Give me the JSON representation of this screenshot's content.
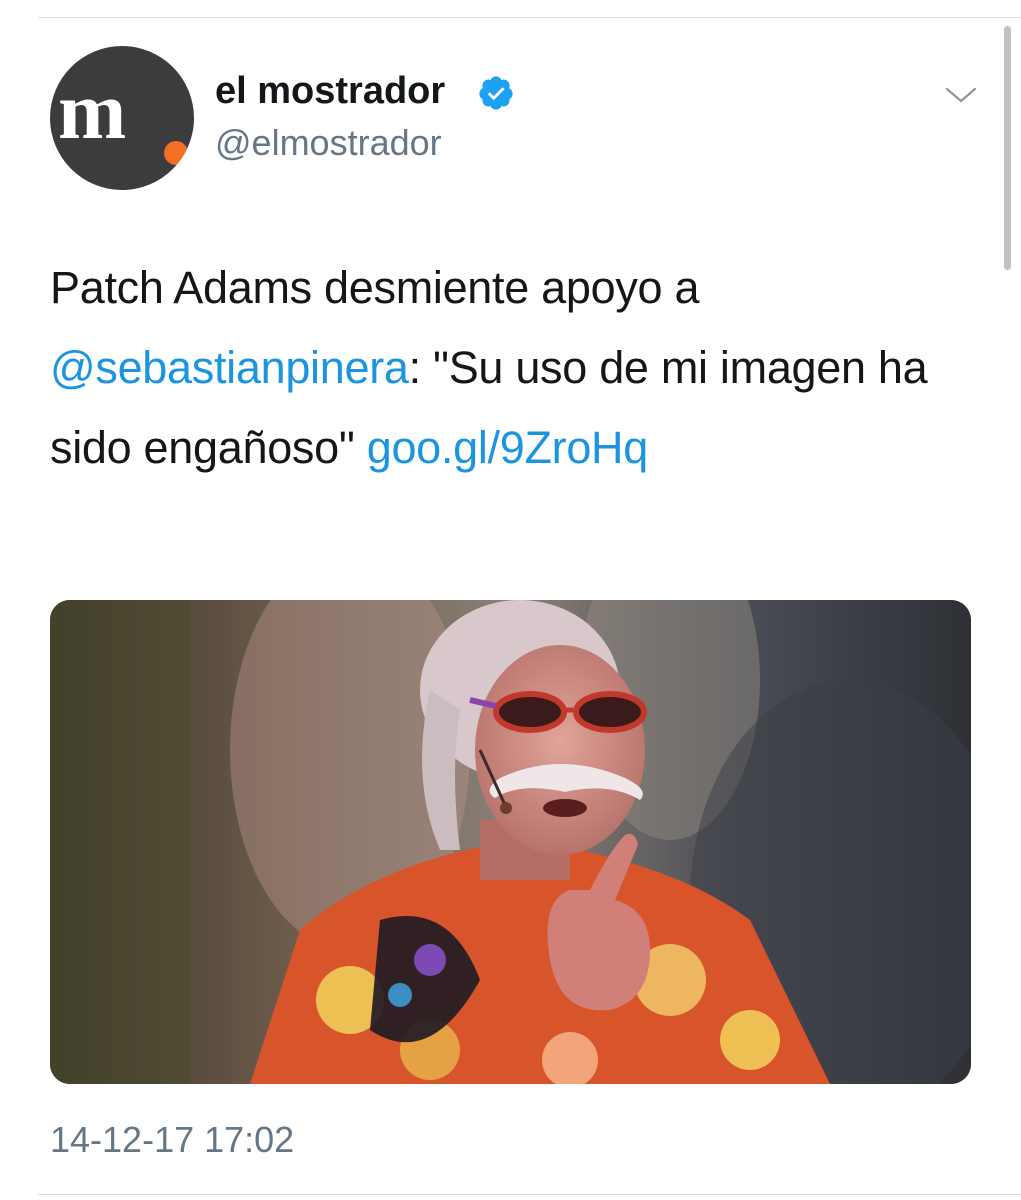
{
  "account": {
    "display_name": "el mostrador",
    "handle": "@elmostrador",
    "avatar_logo_text": "m",
    "verified": true,
    "brand_colors": {
      "avatar_bg": "#3b3c3e",
      "logo_dot": "#f36f21"
    }
  },
  "tweet": {
    "text_before_mention": "Patch Adams desmiente apoyo a ",
    "mention": "@sebastianpinera",
    "text_after_mention": ": \"Su uso de mi imagen ha sido engañoso\" ",
    "link": "goo.gl/​9ZroHq"
  },
  "media": {
    "alt": "Patch Adams con anteojos rojos y camisa floreada, levantando el dedo índice"
  },
  "timestamp": "14-12-17 17:02",
  "icons": {
    "verified": "verified-badge-icon",
    "menu": "chevron-down-icon"
  },
  "colors": {
    "link": "#1b95e0",
    "secondary_text": "#657786",
    "primary_text": "#14171a",
    "verified_badge": "#1da1f2"
  }
}
